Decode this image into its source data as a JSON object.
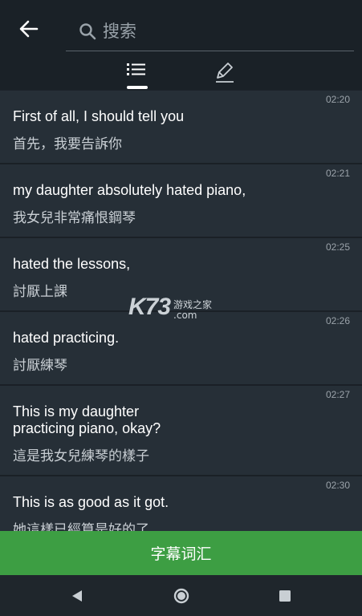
{
  "header": {
    "search_placeholder": "搜索"
  },
  "tabs": [
    {
      "icon": "list-icon",
      "active": true
    },
    {
      "icon": "edit-icon",
      "active": false
    }
  ],
  "rows": [
    {
      "time": "02:20",
      "en": "First of all, I should tell you",
      "zh": "首先，我要告訴你"
    },
    {
      "time": "02:21",
      "en": "my daughter absolutely hated piano,",
      "zh": "我女兒非常痛恨鋼琴"
    },
    {
      "time": "02:25",
      "en": "hated the lessons,",
      "zh": "討厭上課"
    },
    {
      "time": "02:26",
      "en": "hated practicing.",
      "zh": "討厭練琴"
    },
    {
      "time": "02:27",
      "en": "This is my daughter\npracticing piano, okay?",
      "zh": "這是我女兒練琴的樣子"
    },
    {
      "time": "02:30",
      "en": "This is as good as it got.",
      "zh": "她這樣已經算是好的了"
    }
  ],
  "watermark": {
    "brand": "K73",
    "site_cn": "游戏之家",
    "domain": ".com"
  },
  "bottom_button": {
    "label": "字幕词汇"
  },
  "colors": {
    "accent": "#3d9e43",
    "background": "#1c232a",
    "row": "#262f37"
  }
}
